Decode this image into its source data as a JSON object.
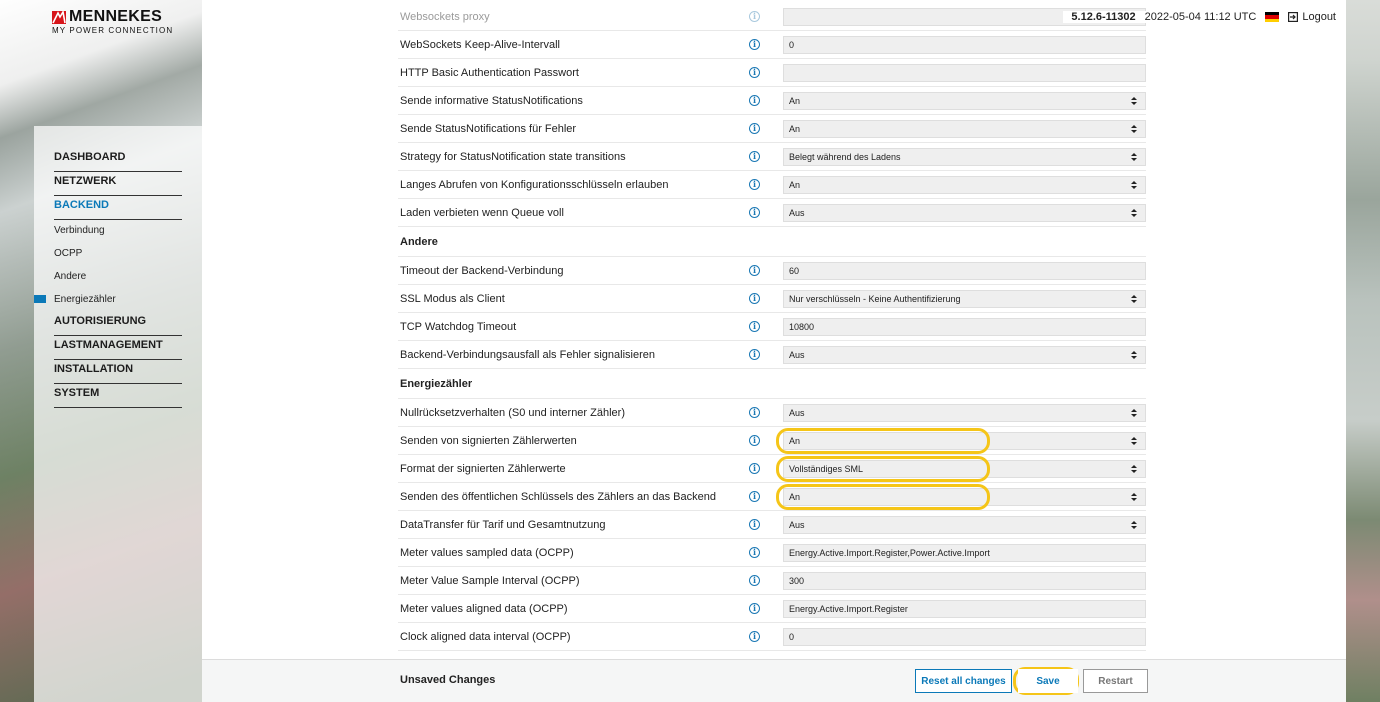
{
  "brand": {
    "name": "MENNEKES",
    "tagline": "MY POWER CONNECTION"
  },
  "header": {
    "version": "5.12.6-11302",
    "datetime": "2022-05-04 11:12 UTC",
    "logout_label": "Logout"
  },
  "sidebar": {
    "items": [
      {
        "label": "DASHBOARD"
      },
      {
        "label": "NETZWERK"
      },
      {
        "label": "BACKEND"
      },
      {
        "label": "Verbindung"
      },
      {
        "label": "OCPP"
      },
      {
        "label": "Andere"
      },
      {
        "label": "Energiezähler"
      },
      {
        "label": "AUTORISIERUNG"
      },
      {
        "label": "LASTMANAGEMENT"
      },
      {
        "label": "INSTALLATION"
      },
      {
        "label": "SYSTEM"
      }
    ]
  },
  "settings": {
    "r0": {
      "label": "Websockets proxy",
      "value": ""
    },
    "r1": {
      "label": "WebSockets Keep-Alive-Intervall",
      "value": "0"
    },
    "r2": {
      "label": "HTTP Basic Authentication Passwort",
      "value": ""
    },
    "r3": {
      "label": "Sende informative StatusNotifications",
      "value": "An"
    },
    "r4": {
      "label": "Sende StatusNotifications für Fehler",
      "value": "An"
    },
    "r5": {
      "label": "Strategy for StatusNotification state transitions",
      "value": "Belegt während des Ladens"
    },
    "r6": {
      "label": "Langes Abrufen von Konfigurationsschlüsseln erlauben",
      "value": "An"
    },
    "r7": {
      "label": "Laden verbieten wenn Queue voll",
      "value": "Aus"
    },
    "section_andere": "Andere",
    "r8": {
      "label": "Timeout der Backend-Verbindung",
      "value": "60"
    },
    "r9": {
      "label": "SSL Modus als Client",
      "value": "Nur verschlüsseln - Keine Authentifizierung"
    },
    "r10": {
      "label": "TCP Watchdog Timeout",
      "value": "10800"
    },
    "r11": {
      "label": "Backend-Verbindungsausfall als Fehler signalisieren",
      "value": "Aus"
    },
    "section_energie": "Energiezähler",
    "r12": {
      "label": "Nullrücksetzverhalten (S0 und interner Zähler)",
      "value": "Aus"
    },
    "r13": {
      "label": "Senden von signierten Zählerwerten",
      "value": "An"
    },
    "r14": {
      "label": "Format der signierten Zählerwerte",
      "value": "Vollständiges SML"
    },
    "r15": {
      "label": "Senden des öffentlichen Schlüssels des Zählers an das Backend",
      "value": "An"
    },
    "r16": {
      "label": "DataTransfer für Tarif und Gesamtnutzung",
      "value": "Aus"
    },
    "r17": {
      "label": "Meter values sampled data (OCPP)",
      "value": "Energy.Active.Import.Register,Power.Active.Import"
    },
    "r18": {
      "label": "Meter Value Sample Interval (OCPP)",
      "value": "300"
    },
    "r19": {
      "label": "Meter values aligned data (OCPP)",
      "value": "Energy.Active.Import.Register"
    },
    "r20": {
      "label": "Clock aligned data interval (OCPP)",
      "value": "0"
    }
  },
  "footer": {
    "unsaved_label": "Unsaved Changes",
    "reset_label": "Reset all changes",
    "save_label": "Save",
    "restart_label": "Restart"
  },
  "colors": {
    "accent": "#0b79b8",
    "highlight": "#f5c518",
    "flag_top": "#000000",
    "flag_mid": "#dd0000",
    "flag_bot": "#ffce00"
  }
}
